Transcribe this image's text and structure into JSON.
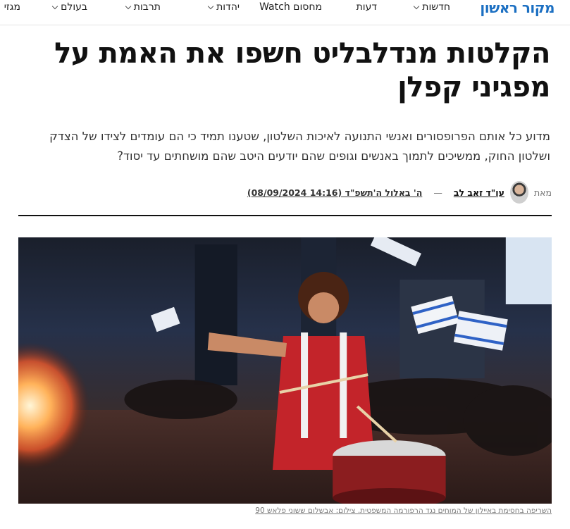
{
  "nav": {
    "logo": "מקור ראשון",
    "items": [
      {
        "label": "חדשות",
        "has_dropdown": true
      },
      {
        "label": "דעות",
        "has_dropdown": false
      },
      {
        "label": "מחסום Watch",
        "has_dropdown": false
      },
      {
        "label": "יהדות",
        "has_dropdown": true
      },
      {
        "label": "תרבות",
        "has_dropdown": true
      },
      {
        "label": "בעולם",
        "has_dropdown": true
      },
      {
        "label": "מגזי",
        "has_dropdown": false
      }
    ]
  },
  "article": {
    "headline": "הקלטות מנדלבליט חשפו את האמת על מפגיני קפלן",
    "subtitle": "מדוע כל אותם הפרופסורים ואנשי התנועה לאיכות השלטון, שטענו תמיד כי הם עומדים לצידו של הצדק ושלטון החוק, ממשיכים לתמוך באנשים וגופים שהם יודעים היטב שהם מושחתים עד יסוד?",
    "byline": {
      "by_label": "מאת",
      "author": "עו\"ד זאב לב",
      "date": "ה' באלול ה'תשפ\"ד (14:16 08/09/2024)"
    },
    "image_caption": "השריפה בחסימת באיילון של המוחים נגד הרפורמה המשפטית. צילום: אבשלום ששוני פלאש 90"
  }
}
